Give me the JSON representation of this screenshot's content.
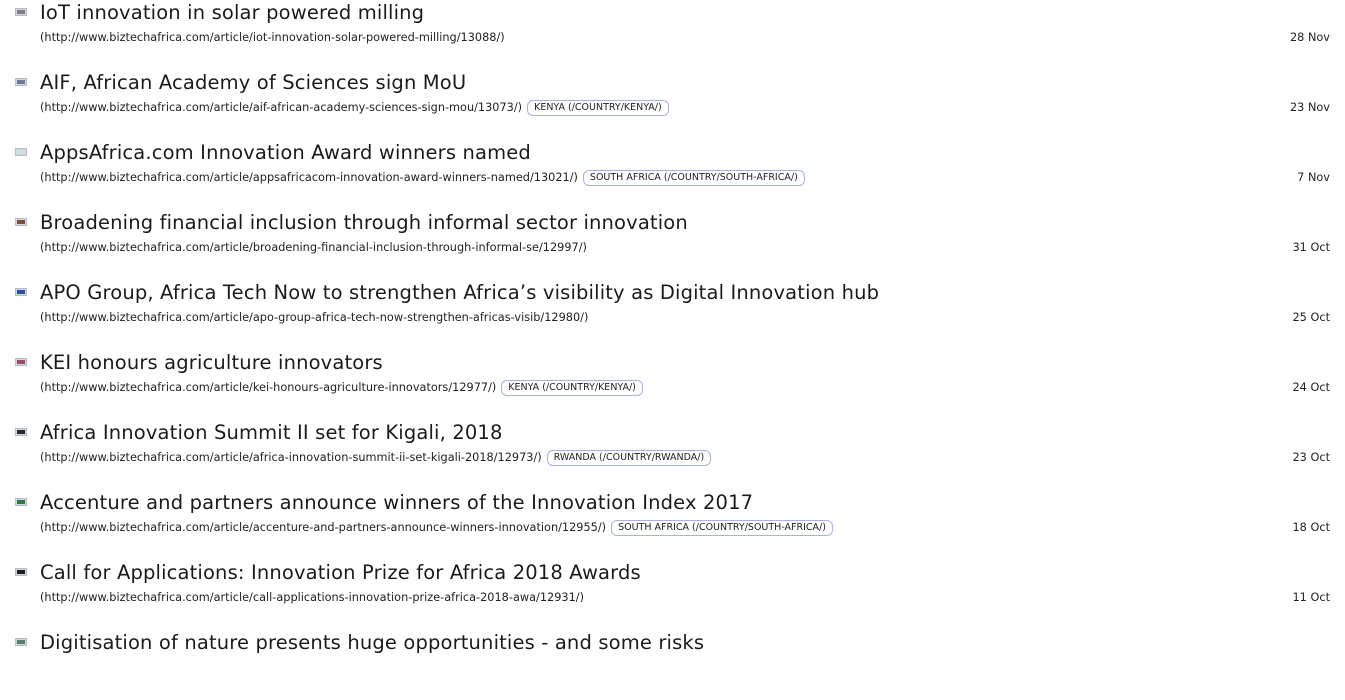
{
  "colors": {
    "tag_border": "#a9b1e0",
    "text": "#222222",
    "background": "#ffffff"
  },
  "articles": [
    {
      "title": "IoT innovation in solar powered milling",
      "url": "(http://www.biztechafrica.com/article/iot-innovation-solar-powered-milling/13088/)",
      "tag": "",
      "date": "28 Nov",
      "thumb_icon": "article-thumbnail-icon",
      "thumb_color": "#8c7a86"
    },
    {
      "title": "AIF, African Academy of Sciences sign MoU",
      "url": "(http://www.biztechafrica.com/article/aif-african-academy-sciences-sign-mou/13073/)",
      "tag": "KENYA (/COUNTRY/KENYA/)",
      "date": "23 Nov",
      "thumb_icon": "article-thumbnail-icon",
      "thumb_color": "#6e7b8c"
    },
    {
      "title": "AppsAfrica.com Innovation Award winners named",
      "url": "(http://www.biztechafrica.com/article/appsafricacom-innovation-award-winners-named/13021/)",
      "tag": "SOUTH AFRICA (/COUNTRY/SOUTH-AFRICA/)",
      "date": "7 Nov",
      "thumb_icon": "article-thumbnail-icon",
      "thumb_color": "#d9dde3"
    },
    {
      "title": "Broadening financial inclusion through informal sector innovation",
      "url": "(http://www.biztechafrica.com/article/broadening-financial-inclusion-through-informal-se/12997/)",
      "tag": "",
      "date": "31 Oct",
      "thumb_icon": "article-thumbnail-icon",
      "thumb_color": "#7a4e3a"
    },
    {
      "title": "APO Group, Africa Tech Now to strengthen Africa’s visibility as Digital Innovation hub",
      "url": "(http://www.biztechafrica.com/article/apo-group-africa-tech-now-strengthen-africas-visib/12980/)",
      "tag": "",
      "date": "25 Oct",
      "thumb_icon": "article-thumbnail-icon",
      "thumb_color": "#2c4f9e"
    },
    {
      "title": "KEI honours agriculture innovators",
      "url": "(http://www.biztechafrica.com/article/kei-honours-agriculture-innovators/12977/)",
      "tag": "KENYA (/COUNTRY/KENYA/)",
      "date": "24 Oct",
      "thumb_icon": "article-thumbnail-icon",
      "thumb_color": "#9b4d5c"
    },
    {
      "title": "Africa Innovation Summit II set for Kigali, 2018",
      "url": "(http://www.biztechafrica.com/article/africa-innovation-summit-ii-set-kigali-2018/12973/)",
      "tag": "RWANDA (/COUNTRY/RWANDA/)",
      "date": "23 Oct",
      "thumb_icon": "article-thumbnail-icon",
      "thumb_color": "#2a2a2a"
    },
    {
      "title": "Accenture and partners announce winners of the Innovation Index 2017",
      "url": "(http://www.biztechafrica.com/article/accenture-and-partners-announce-winners-innovation/12955/)",
      "tag": "SOUTH AFRICA (/COUNTRY/SOUTH-AFRICA/)",
      "date": "18 Oct",
      "thumb_icon": "article-thumbnail-icon",
      "thumb_color": "#2f7a3a"
    },
    {
      "title": "Call for Applications: Innovation Prize for Africa 2018 Awards",
      "url": "(http://www.biztechafrica.com/article/call-applications-innovation-prize-africa-2018-awa/12931/)",
      "tag": "",
      "date": "11 Oct",
      "thumb_icon": "article-thumbnail-icon",
      "thumb_color": "#1f1f1f"
    },
    {
      "title": "Digitisation of nature presents huge opportunities - and some risks",
      "url": "",
      "tag": "",
      "date": "",
      "thumb_icon": "article-thumbnail-icon",
      "thumb_color": "#5c7d6a"
    }
  ]
}
